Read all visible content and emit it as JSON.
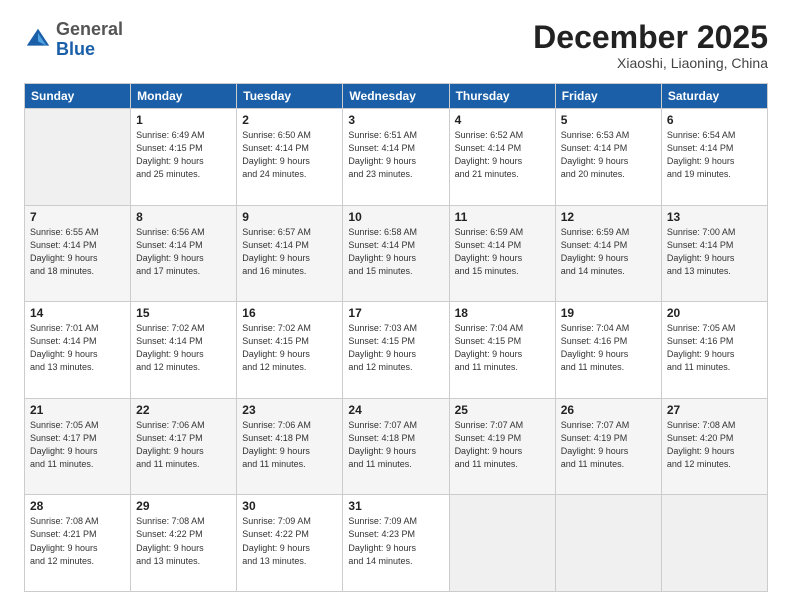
{
  "logo": {
    "general": "General",
    "blue": "Blue"
  },
  "header": {
    "month": "December 2025",
    "location": "Xiaoshi, Liaoning, China"
  },
  "days_of_week": [
    "Sunday",
    "Monday",
    "Tuesday",
    "Wednesday",
    "Thursday",
    "Friday",
    "Saturday"
  ],
  "weeks": [
    [
      {
        "day": "",
        "info": ""
      },
      {
        "day": "1",
        "info": "Sunrise: 6:49 AM\nSunset: 4:15 PM\nDaylight: 9 hours\nand 25 minutes."
      },
      {
        "day": "2",
        "info": "Sunrise: 6:50 AM\nSunset: 4:14 PM\nDaylight: 9 hours\nand 24 minutes."
      },
      {
        "day": "3",
        "info": "Sunrise: 6:51 AM\nSunset: 4:14 PM\nDaylight: 9 hours\nand 23 minutes."
      },
      {
        "day": "4",
        "info": "Sunrise: 6:52 AM\nSunset: 4:14 PM\nDaylight: 9 hours\nand 21 minutes."
      },
      {
        "day": "5",
        "info": "Sunrise: 6:53 AM\nSunset: 4:14 PM\nDaylight: 9 hours\nand 20 minutes."
      },
      {
        "day": "6",
        "info": "Sunrise: 6:54 AM\nSunset: 4:14 PM\nDaylight: 9 hours\nand 19 minutes."
      }
    ],
    [
      {
        "day": "7",
        "info": "Sunrise: 6:55 AM\nSunset: 4:14 PM\nDaylight: 9 hours\nand 18 minutes."
      },
      {
        "day": "8",
        "info": "Sunrise: 6:56 AM\nSunset: 4:14 PM\nDaylight: 9 hours\nand 17 minutes."
      },
      {
        "day": "9",
        "info": "Sunrise: 6:57 AM\nSunset: 4:14 PM\nDaylight: 9 hours\nand 16 minutes."
      },
      {
        "day": "10",
        "info": "Sunrise: 6:58 AM\nSunset: 4:14 PM\nDaylight: 9 hours\nand 15 minutes."
      },
      {
        "day": "11",
        "info": "Sunrise: 6:59 AM\nSunset: 4:14 PM\nDaylight: 9 hours\nand 15 minutes."
      },
      {
        "day": "12",
        "info": "Sunrise: 6:59 AM\nSunset: 4:14 PM\nDaylight: 9 hours\nand 14 minutes."
      },
      {
        "day": "13",
        "info": "Sunrise: 7:00 AM\nSunset: 4:14 PM\nDaylight: 9 hours\nand 13 minutes."
      }
    ],
    [
      {
        "day": "14",
        "info": "Sunrise: 7:01 AM\nSunset: 4:14 PM\nDaylight: 9 hours\nand 13 minutes."
      },
      {
        "day": "15",
        "info": "Sunrise: 7:02 AM\nSunset: 4:14 PM\nDaylight: 9 hours\nand 12 minutes."
      },
      {
        "day": "16",
        "info": "Sunrise: 7:02 AM\nSunset: 4:15 PM\nDaylight: 9 hours\nand 12 minutes."
      },
      {
        "day": "17",
        "info": "Sunrise: 7:03 AM\nSunset: 4:15 PM\nDaylight: 9 hours\nand 12 minutes."
      },
      {
        "day": "18",
        "info": "Sunrise: 7:04 AM\nSunset: 4:15 PM\nDaylight: 9 hours\nand 11 minutes."
      },
      {
        "day": "19",
        "info": "Sunrise: 7:04 AM\nSunset: 4:16 PM\nDaylight: 9 hours\nand 11 minutes."
      },
      {
        "day": "20",
        "info": "Sunrise: 7:05 AM\nSunset: 4:16 PM\nDaylight: 9 hours\nand 11 minutes."
      }
    ],
    [
      {
        "day": "21",
        "info": "Sunrise: 7:05 AM\nSunset: 4:17 PM\nDaylight: 9 hours\nand 11 minutes."
      },
      {
        "day": "22",
        "info": "Sunrise: 7:06 AM\nSunset: 4:17 PM\nDaylight: 9 hours\nand 11 minutes."
      },
      {
        "day": "23",
        "info": "Sunrise: 7:06 AM\nSunset: 4:18 PM\nDaylight: 9 hours\nand 11 minutes."
      },
      {
        "day": "24",
        "info": "Sunrise: 7:07 AM\nSunset: 4:18 PM\nDaylight: 9 hours\nand 11 minutes."
      },
      {
        "day": "25",
        "info": "Sunrise: 7:07 AM\nSunset: 4:19 PM\nDaylight: 9 hours\nand 11 minutes."
      },
      {
        "day": "26",
        "info": "Sunrise: 7:07 AM\nSunset: 4:19 PM\nDaylight: 9 hours\nand 11 minutes."
      },
      {
        "day": "27",
        "info": "Sunrise: 7:08 AM\nSunset: 4:20 PM\nDaylight: 9 hours\nand 12 minutes."
      }
    ],
    [
      {
        "day": "28",
        "info": "Sunrise: 7:08 AM\nSunset: 4:21 PM\nDaylight: 9 hours\nand 12 minutes."
      },
      {
        "day": "29",
        "info": "Sunrise: 7:08 AM\nSunset: 4:22 PM\nDaylight: 9 hours\nand 13 minutes."
      },
      {
        "day": "30",
        "info": "Sunrise: 7:09 AM\nSunset: 4:22 PM\nDaylight: 9 hours\nand 13 minutes."
      },
      {
        "day": "31",
        "info": "Sunrise: 7:09 AM\nSunset: 4:23 PM\nDaylight: 9 hours\nand 14 minutes."
      },
      {
        "day": "",
        "info": ""
      },
      {
        "day": "",
        "info": ""
      },
      {
        "day": "",
        "info": ""
      }
    ]
  ]
}
